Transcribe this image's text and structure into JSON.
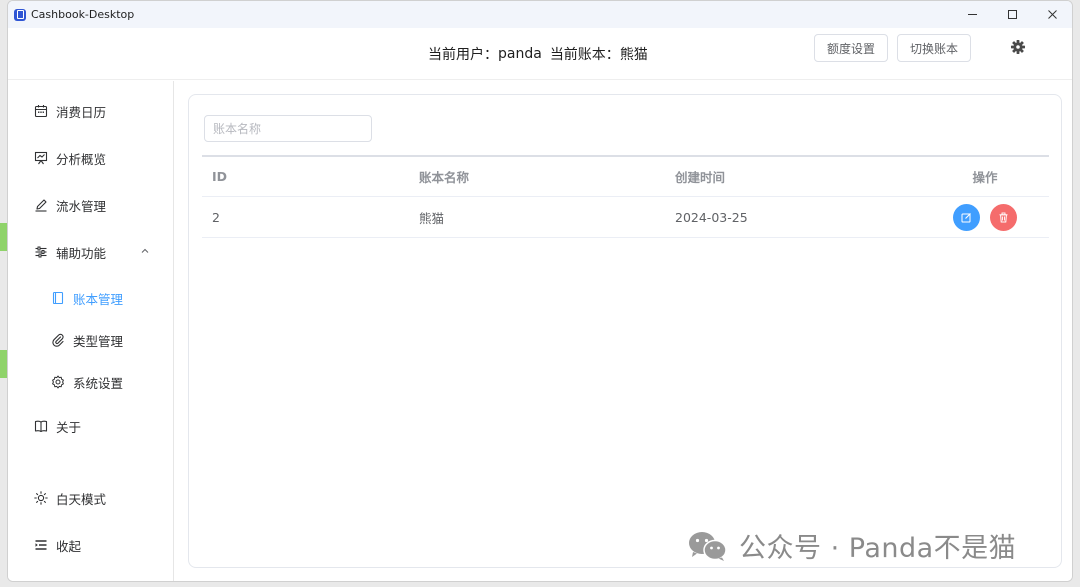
{
  "window": {
    "title": "Cashbook-Desktop"
  },
  "header": {
    "current_user_label": "当前用户：",
    "current_user": "panda",
    "current_book_label": "当前账本：",
    "current_book": "熊猫",
    "quota_button": "额度设置",
    "switch_button": "切换账本"
  },
  "sidebar": {
    "items": [
      {
        "label": "消费日历",
        "icon": "calendar-icon"
      },
      {
        "label": "分析概览",
        "icon": "chart-board-icon"
      },
      {
        "label": "流水管理",
        "icon": "pen-icon"
      },
      {
        "label": "辅助功能",
        "icon": "sliders-icon",
        "expanded": true
      },
      {
        "label": "账本管理",
        "icon": "notebook-icon",
        "active": true
      },
      {
        "label": "类型管理",
        "icon": "paperclip-icon"
      },
      {
        "label": "系统设置",
        "icon": "gear-icon"
      },
      {
        "label": "关于",
        "icon": "book-icon"
      },
      {
        "label": "白天模式",
        "icon": "sun-icon"
      },
      {
        "label": "收起",
        "icon": "fold-icon"
      }
    ]
  },
  "search": {
    "placeholder": "账本名称",
    "value": ""
  },
  "table": {
    "columns": [
      "ID",
      "账本名称",
      "创建时间",
      "操作"
    ],
    "rows": [
      {
        "id": "2",
        "name": "熊猫",
        "created": "2024-03-25"
      }
    ]
  },
  "colors": {
    "accent": "#409eff",
    "danger": "#f56c6c"
  },
  "watermark": {
    "text": "公众号 · Panda不是猫"
  }
}
